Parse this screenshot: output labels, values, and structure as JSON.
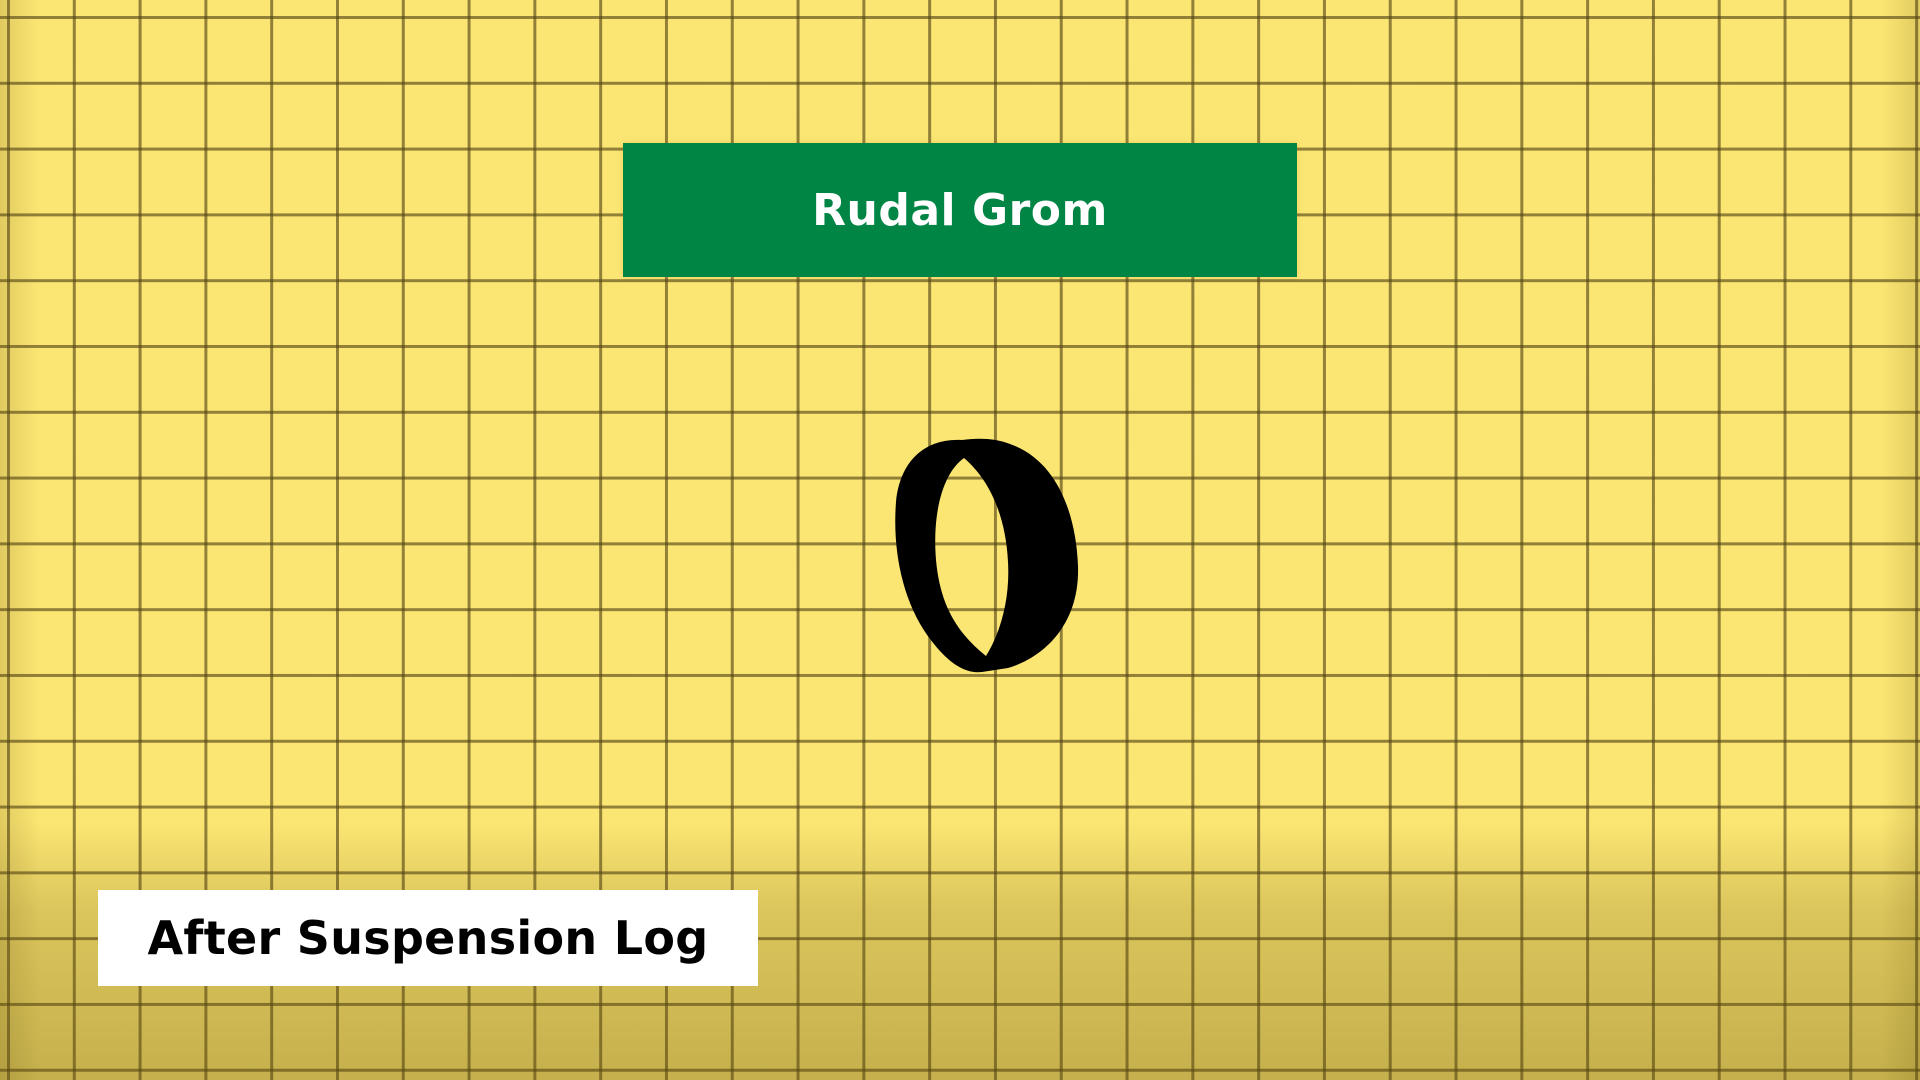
{
  "title": "Rudal Grom",
  "caption": "After Suspension Log",
  "icon": "ring-icon",
  "colors": {
    "background": "#fce673",
    "grid_lines": "#504214",
    "title_banner": "#008545",
    "title_text": "#ffffff",
    "caption_box": "#ffffff",
    "caption_text": "#000000",
    "ring": "#000000"
  }
}
